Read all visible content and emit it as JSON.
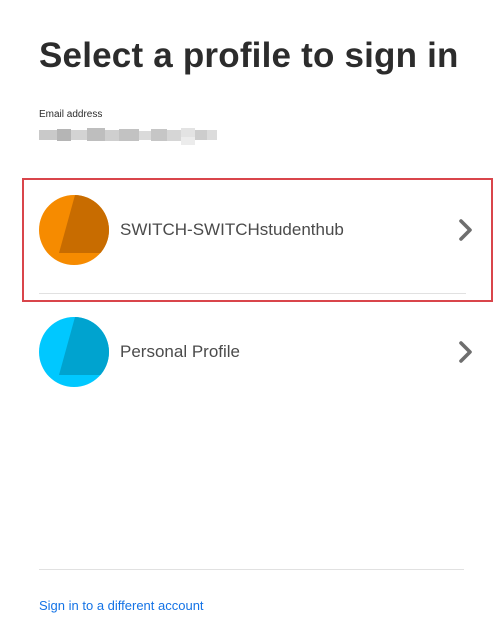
{
  "page": {
    "title": "Select a profile to sign in"
  },
  "email": {
    "label": "Email address",
    "value_blurred": true
  },
  "profiles": [
    {
      "name": "SWITCH-SWITCHstudenthub",
      "avatar_icon": "adobe-profile-orange-icon",
      "avatar_color": "#f68b00",
      "avatar_shade": "#c86c00",
      "selected": true
    },
    {
      "name": "Personal Profile",
      "avatar_icon": "adobe-profile-blue-icon",
      "avatar_color": "#00c8ff",
      "avatar_shade": "#00a3cf",
      "selected": false
    }
  ],
  "footer": {
    "link_label": "Sign in to a different account",
    "link_color": "#1473e6"
  },
  "colors": {
    "selection_outline": "#d9454b",
    "title_text": "#2c2c2c"
  }
}
